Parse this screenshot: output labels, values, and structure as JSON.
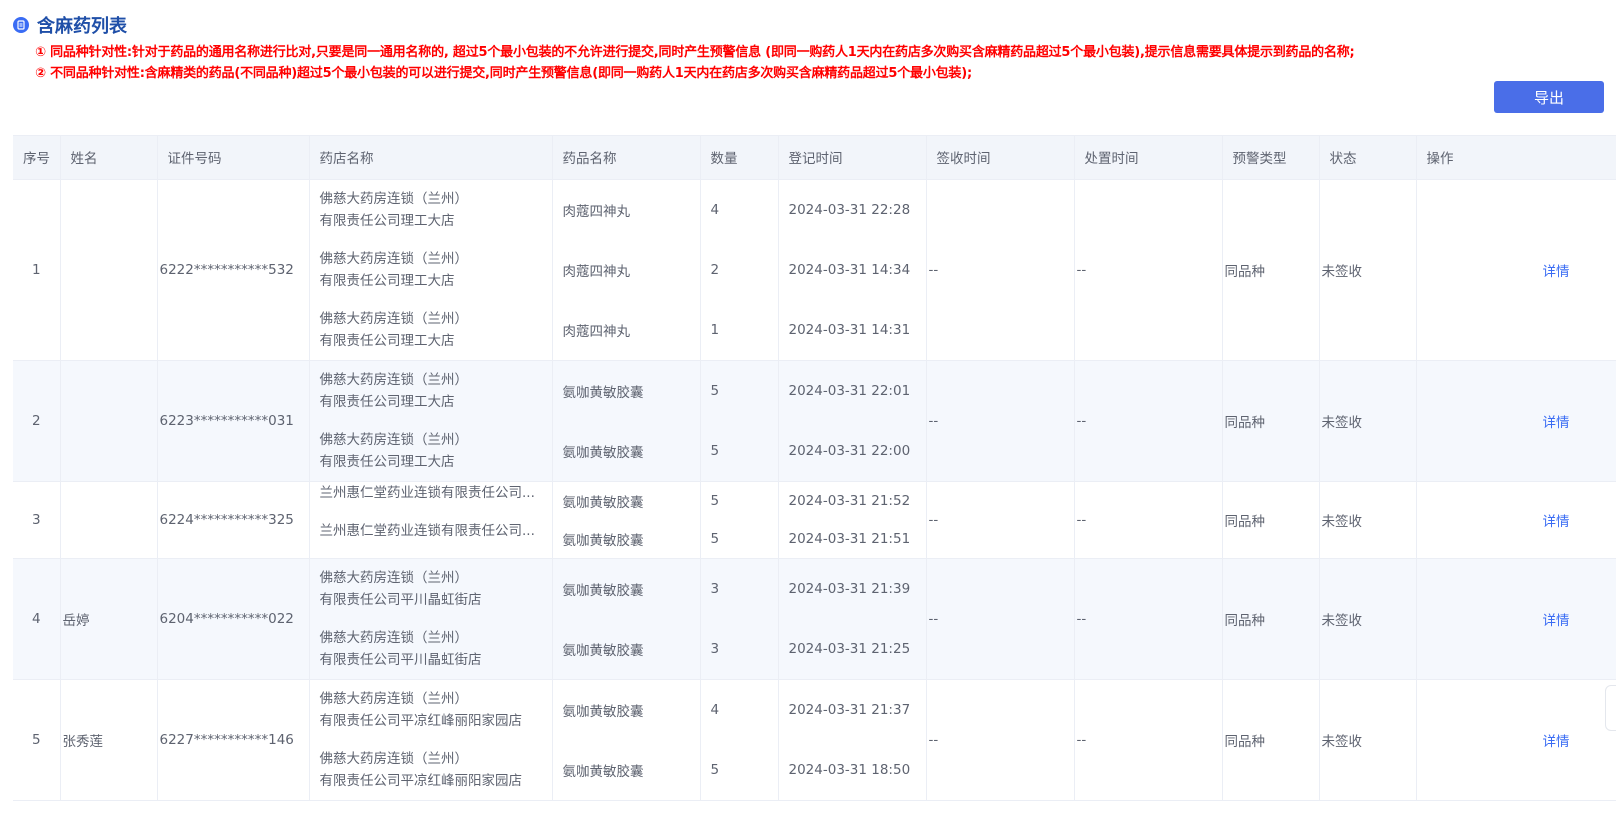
{
  "header": {
    "title": "含麻药列表",
    "rule1": "① 同品种针对性:针对于药品的通用名称进行比对,只要是同一通用名称的, 超过5个最小包装的不允许进行提交,同时产生预警信息 (即同一购药人1天内在药店多次购买含麻精药品超过5个最小包装),提示信息需要具体提示到药品的名称;",
    "rule2": "② 不同品种针对性:含麻精类的药品(不同品种)超过5个最小包装的可以进行提交,同时产生预警信息(即同一购药人1天内在药店多次购买含麻精药品超过5个最小包装);",
    "export_label": "导出"
  },
  "table": {
    "columns": [
      "序号",
      "姓名",
      "证件号码",
      "药店名称",
      "药品名称",
      "数量",
      "登记时间",
      "签收时间",
      "处置时间",
      "预警类型",
      "状态",
      "操作"
    ],
    "rows": [
      {
        "idx": "1",
        "name": "",
        "id_no": "6222***********532",
        "entries": [
          {
            "pharmacy": "佛慈大药房连锁（兰州）\n有限责任公司理工大店",
            "drug": "肉蔻四神丸",
            "qty": "4",
            "time": "2024-03-31 22:28"
          },
          {
            "pharmacy": "佛慈大药房连锁（兰州）\n有限责任公司理工大店",
            "drug": "肉蔻四神丸",
            "qty": "2",
            "time": "2024-03-31 14:34"
          },
          {
            "pharmacy": "佛慈大药房连锁（兰州）\n有限责任公司理工大店",
            "drug": "肉蔻四神丸",
            "qty": "1",
            "time": "2024-03-31 14:31"
          }
        ],
        "sign_time": "--",
        "handle_time": "--",
        "warn_type": "同品种",
        "status": "未签收",
        "op": "详情"
      },
      {
        "idx": "2",
        "name": "",
        "id_no": "6223***********031",
        "entries": [
          {
            "pharmacy": "佛慈大药房连锁（兰州）\n有限责任公司理工大店",
            "drug": "氨咖黄敏胶囊",
            "qty": "5",
            "time": "2024-03-31 22:01"
          },
          {
            "pharmacy": "佛慈大药房连锁（兰州）\n有限责任公司理工大店",
            "drug": "氨咖黄敏胶囊",
            "qty": "5",
            "time": "2024-03-31 22:00"
          }
        ],
        "sign_time": "--",
        "handle_time": "--",
        "warn_type": "同品种",
        "status": "未签收",
        "op": "详情"
      },
      {
        "idx": "3",
        "name": "",
        "id_no": "6224***********325",
        "entries": [
          {
            "pharmacy": "兰州惠仁堂药业连锁有限责任公司...",
            "drug": "氨咖黄敏胶囊",
            "qty": "5",
            "time": "2024-03-31 21:52"
          },
          {
            "pharmacy": "兰州惠仁堂药业连锁有限责任公司...",
            "drug": "氨咖黄敏胶囊",
            "qty": "5",
            "time": "2024-03-31 21:51"
          }
        ],
        "sign_time": "--",
        "handle_time": "--",
        "warn_type": "同品种",
        "status": "未签收",
        "op": "详情"
      },
      {
        "idx": "4",
        "name": "岳婷",
        "id_no": "6204***********022",
        "entries": [
          {
            "pharmacy": "佛慈大药房连锁（兰州）\n有限责任公司平川晶虹街店",
            "drug": "氨咖黄敏胶囊",
            "qty": "3",
            "time": "2024-03-31 21:39"
          },
          {
            "pharmacy": "佛慈大药房连锁（兰州）\n有限责任公司平川晶虹街店",
            "drug": "氨咖黄敏胶囊",
            "qty": "3",
            "time": "2024-03-31 21:25"
          }
        ],
        "sign_time": "--",
        "handle_time": "--",
        "warn_type": "同品种",
        "status": "未签收",
        "op": "详情"
      },
      {
        "idx": "5",
        "name": "张秀莲",
        "id_no": "6227***********146",
        "entries": [
          {
            "pharmacy": "佛慈大药房连锁（兰州）\n有限责任公司平凉红峰丽阳家园店",
            "drug": "氨咖黄敏胶囊",
            "qty": "4",
            "time": "2024-03-31 21:37"
          },
          {
            "pharmacy": "佛慈大药房连锁（兰州）\n有限责任公司平凉红峰丽阳家园店",
            "drug": "氨咖黄敏胶囊",
            "qty": "5",
            "time": "2024-03-31 18:50"
          }
        ],
        "sign_time": "--",
        "handle_time": "--",
        "warn_type": "同品种",
        "status": "未签收",
        "op": "详情"
      }
    ]
  },
  "colors": {
    "title": "#1f4fa8",
    "rule_text": "#ff0000",
    "export_button": "#4a6ee8",
    "link": "#3a6cf4",
    "header_bg": "#f2f5fa",
    "stripe_bg": "#f5f8fd"
  },
  "icons": {
    "title_icon": "document-badge-icon"
  }
}
